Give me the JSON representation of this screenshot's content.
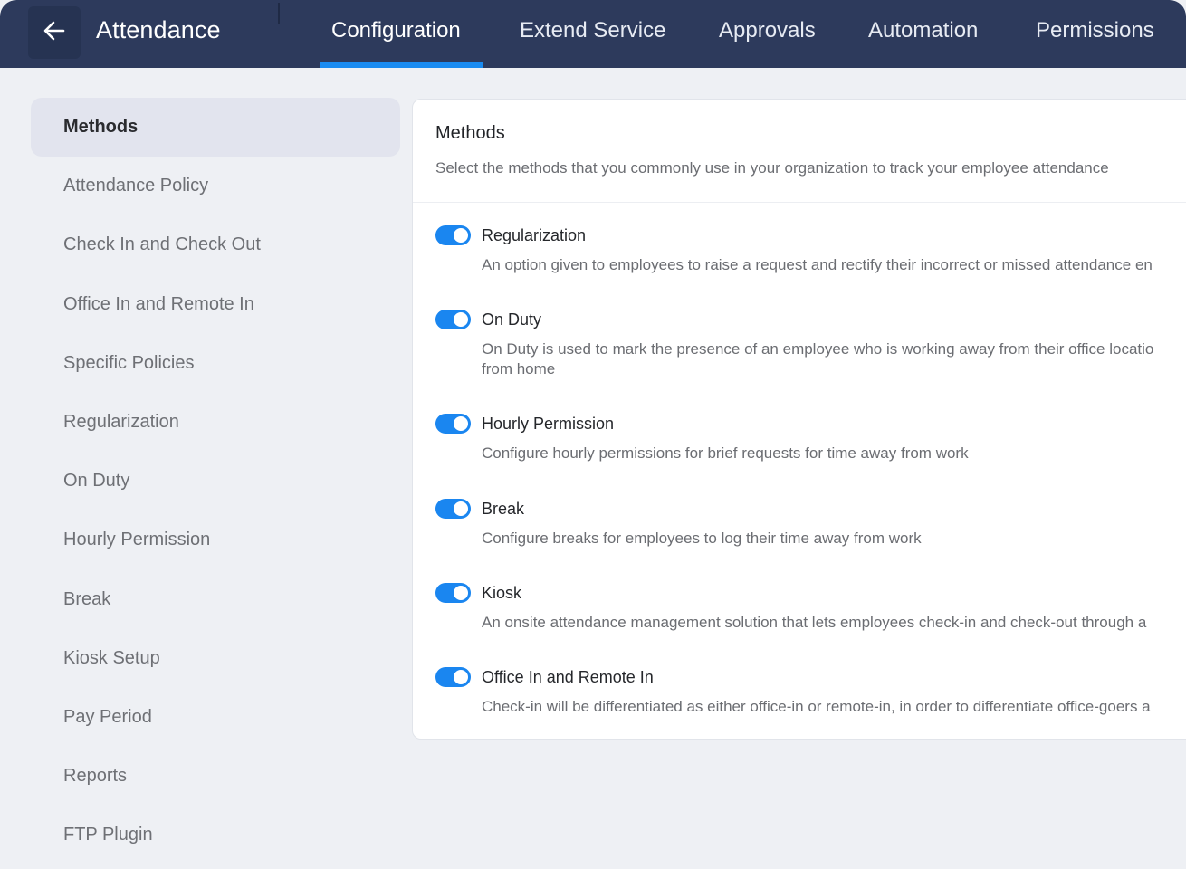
{
  "header": {
    "back_icon": "arrow-left-icon",
    "title": "Attendance",
    "tabs": [
      {
        "label": "Configuration",
        "active": true
      },
      {
        "label": "Extend Service",
        "active": false
      },
      {
        "label": "Approvals",
        "active": false
      },
      {
        "label": "Automation",
        "active": false
      },
      {
        "label": "Permissions",
        "active": false
      }
    ]
  },
  "sidebar": {
    "items": [
      {
        "label": "Methods",
        "active": true
      },
      {
        "label": "Attendance Policy"
      },
      {
        "label": "Check In and Check Out"
      },
      {
        "label": "Office In and Remote In"
      },
      {
        "label": "Specific Policies"
      },
      {
        "label": "Regularization"
      },
      {
        "label": "On Duty"
      },
      {
        "label": "Hourly Permission"
      },
      {
        "label": "Break"
      },
      {
        "label": "Kiosk Setup"
      },
      {
        "label": "Pay Period"
      },
      {
        "label": "Reports"
      },
      {
        "label": "FTP Plugin"
      }
    ]
  },
  "main": {
    "title": "Methods",
    "subtitle": "Select the methods that you commonly use in your organization to track your employee attendance",
    "methods": [
      {
        "name": "Regularization",
        "enabled": true,
        "description": "An option given to employees to raise a request and rectify their incorrect or missed attendance en"
      },
      {
        "name": "On Duty",
        "enabled": true,
        "description": "On Duty is used to mark the presence of an employee who is working away from their office locatio",
        "description_line2": "from home"
      },
      {
        "name": "Hourly Permission",
        "enabled": true,
        "description": "Configure hourly permissions for brief requests for time away from work"
      },
      {
        "name": "Break",
        "enabled": true,
        "description": "Configure breaks for employees to log their time away from work"
      },
      {
        "name": "Kiosk",
        "enabled": true,
        "description": "An onsite attendance management solution that lets employees check-in and check-out through a"
      },
      {
        "name": "Office In and Remote In",
        "enabled": true,
        "description": "Check-in will be differentiated as either office-in or remote-in, in order to differentiate office-goers a"
      }
    ]
  },
  "colors": {
    "header_bg": "#2d3a5c",
    "accent": "#1a86f0",
    "page_bg": "#eef0f4"
  }
}
